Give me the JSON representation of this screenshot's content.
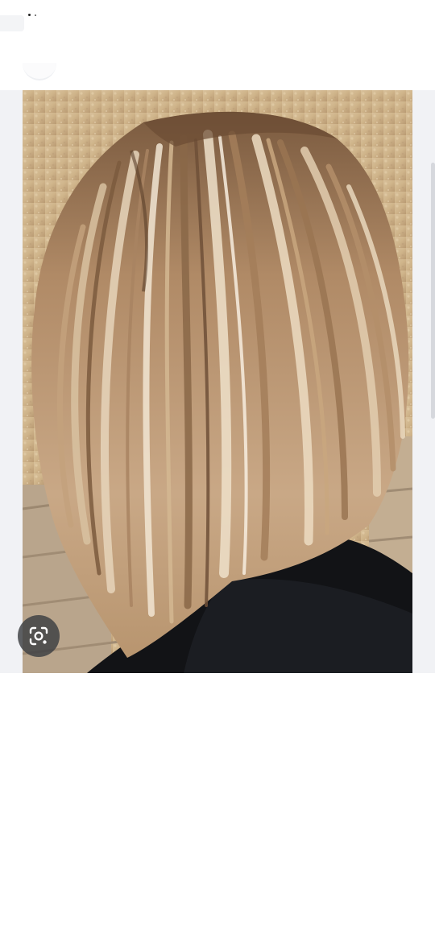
{
  "status_bar": {},
  "header": {},
  "image_viewer": {
    "image_description_name": "hair-photo",
    "lens_button_icon": "visual-search-icon"
  },
  "colors": {
    "panel_bg": "#f1f2f5",
    "lens_button_bg": "#3c3e42"
  }
}
